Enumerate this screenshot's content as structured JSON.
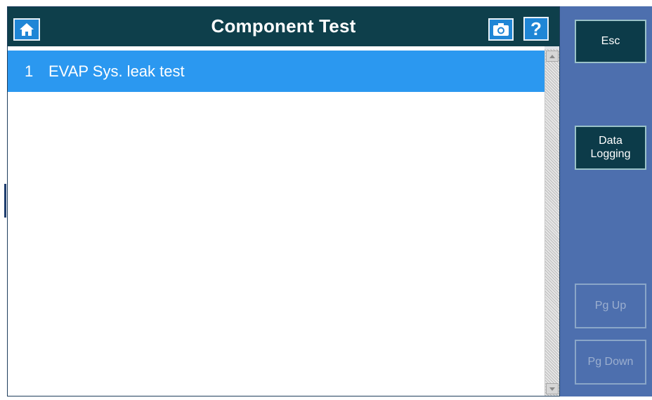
{
  "header": {
    "title": "Component Test",
    "home_icon": "home-icon",
    "camera_icon": "camera-icon",
    "help_label": "?"
  },
  "list": {
    "items": [
      {
        "number": "1",
        "label": "EVAP Sys. leak test",
        "selected": true
      }
    ]
  },
  "sidebar": {
    "esc_label": "Esc",
    "data_logging_label": "Data\nLogging",
    "pg_up_label": "Pg Up",
    "pg_down_label": "Pg Down"
  },
  "colors": {
    "title_bar": "#0e3f4b",
    "selection": "#2b98f0",
    "sidebar": "#4d6fae",
    "button_dark": "#0c3b49",
    "icon_button": "#1f86d6"
  }
}
